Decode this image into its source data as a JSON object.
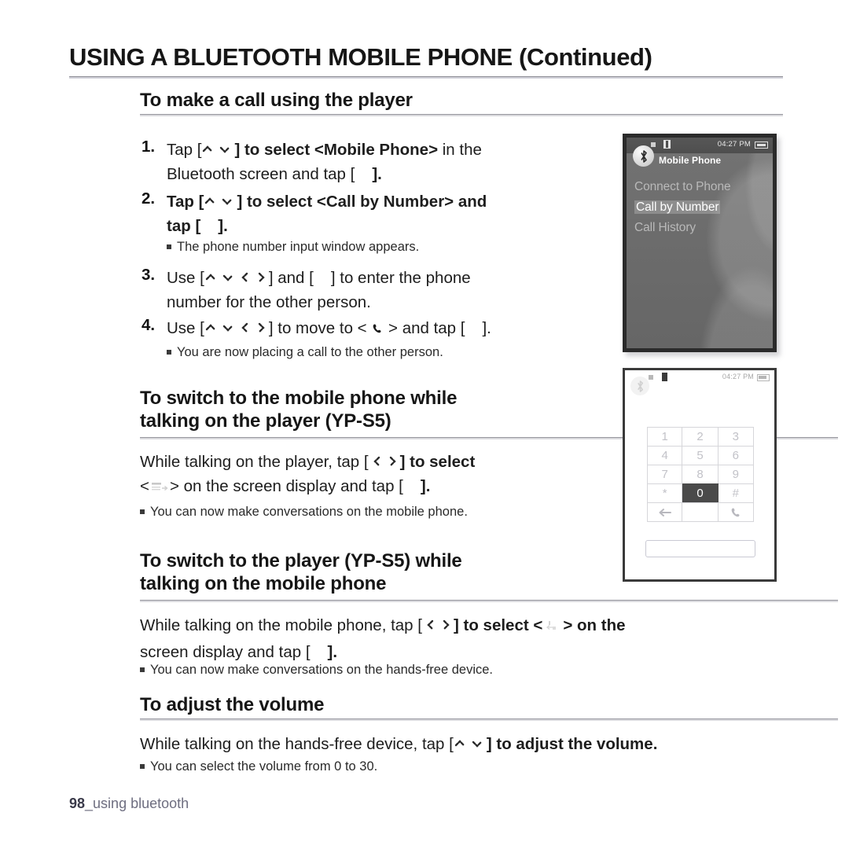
{
  "document": {
    "main_title": "USING A BLUETOOTH MOBILE PHONE (Continued)",
    "page_number": "98",
    "footer_separator": "_",
    "footer_label": "using bluetooth"
  },
  "sections": [
    {
      "heading": "To make a call using the player",
      "steps": [
        {
          "number": "1.",
          "line1_a": "Tap [",
          "line1_keys": "up-down",
          "line1_b": "] to select ",
          "line1_target": "<Mobile Phone>",
          "line1_c": " in the",
          "line2_a": "Bluetooth screen and tap [",
          "line2_b": "].",
          "bold": true
        },
        {
          "number": "2.",
          "line1_a": "Tap [",
          "line1_keys": "up-down",
          "line1_b": "] to select ",
          "line1_target": "<Call by Number>",
          "line1_c": " and",
          "line2_a": "tap [",
          "line2_b": "].",
          "bold": true,
          "note": "The phone number input window appears."
        },
        {
          "number": "3.",
          "line1_a": "Use [",
          "line1_keys": "up-down-left-right",
          "line1_b": "] and [",
          "line1_c": "] to enter the phone",
          "line2_a": "number for the other person.",
          "bold": false
        },
        {
          "number": "4.",
          "line1_a": "Use [",
          "line1_keys": "up-down-left-right",
          "line1_b": "] to move to < ",
          "line1_icon": "call-icon",
          "line1_c": " > and tap [",
          "line1_d": "].",
          "bold": false,
          "note": "You are now placing a call to the other person."
        }
      ]
    },
    {
      "heading_line1": "To switch to the mobile phone while",
      "heading_line2": "talking on the player (YP-S5)",
      "body_line1_a": "While talking on the player, tap [",
      "body_line1_keys": "left-right",
      "body_line1_b": "] to select",
      "body_line2_a": "<",
      "body_line2_icon": "switch-to-phone-icon",
      "body_line2_b": "> on the screen display and tap [",
      "body_line2_c": "].",
      "note": "You can now make conversations on the mobile phone."
    },
    {
      "heading_line1": "To switch to the player (YP-S5) while",
      "heading_line2": "talking on the mobile phone",
      "body_line1_a": "While talking on the mobile phone, tap [",
      "body_line1_keys": "left-right",
      "body_line1_b": "] to select <",
      "body_line1_icon": "switch-to-player-icon",
      "body_line1_c": "> on the",
      "body_line2_a": "screen display and tap [",
      "body_line2_b": "].",
      "note": "You can now make conversations on the hands-free device."
    },
    {
      "heading": "To adjust the volume",
      "body_a": "While talking on the hands-free device, tap [",
      "body_keys": "up-down",
      "body_b": "] to adjust the volume.",
      "note": "You can select the volume from 0 to 30."
    }
  ],
  "device_menu_screen": {
    "status_time": "04:27 PM",
    "title": "Mobile Phone",
    "menu_items": [
      {
        "label": "Connect to Phone",
        "selected": false
      },
      {
        "label": "Call by Number",
        "selected": true
      },
      {
        "label": "Call History",
        "selected": false
      }
    ]
  },
  "device_keypad_screen": {
    "status_time": "04:27 PM",
    "keys": [
      {
        "label": "1",
        "highlighted": false
      },
      {
        "label": "2",
        "highlighted": false
      },
      {
        "label": "3",
        "highlighted": false
      },
      {
        "label": "4",
        "highlighted": false
      },
      {
        "label": "5",
        "highlighted": false
      },
      {
        "label": "6",
        "highlighted": false
      },
      {
        "label": "7",
        "highlighted": false
      },
      {
        "label": "8",
        "highlighted": false
      },
      {
        "label": "9",
        "highlighted": false
      },
      {
        "label": "*",
        "highlighted": false
      },
      {
        "label": "0",
        "highlighted": true
      },
      {
        "label": "#",
        "highlighted": false
      },
      {
        "label": "backspace-icon",
        "highlighted": false
      },
      {
        "label": "",
        "highlighted": false
      },
      {
        "label": "call-icon",
        "highlighted": false
      }
    ],
    "input_value": ""
  },
  "colors": {
    "text": "#1a1a1a",
    "rule_dark": "#8c8c94",
    "rule_light": "#d2d2da",
    "device_screen_bg": "#6e6e6e",
    "highlight": "#4a4a4a",
    "footer_gray": "#6e6e80"
  }
}
